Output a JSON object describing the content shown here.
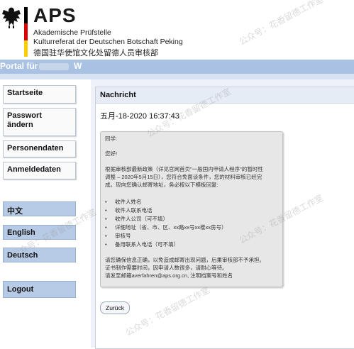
{
  "header": {
    "logo_text": "APS",
    "subtitle_de_1": "Akademische Prüfstelle",
    "subtitle_de_2": "Kulturreferat der Deutschen Botschaft Peking",
    "subtitle_cn": "德国驻华使馆文化处留德人员审核部",
    "flag_colors": [
      "#000000",
      "#dd0000",
      "#ffce00"
    ]
  },
  "portal": {
    "label": "Portal für",
    "name_suffix": "W"
  },
  "sidebar": {
    "items": [
      {
        "label": "Startseite"
      },
      {
        "label": "Passwort\nändern"
      },
      {
        "label": "Personendaten"
      },
      {
        "label": "Anmeldedaten"
      }
    ],
    "languages": [
      {
        "label": "中文"
      },
      {
        "label": "English"
      },
      {
        "label": "Deutsch"
      }
    ],
    "logout": "Logout"
  },
  "message": {
    "title": "Nachricht",
    "date": "五月-18-2020 16:37:43",
    "body": {
      "greeting": "同学:",
      "hello": "您好!",
      "para1_line1": "根据审核部最新政策（详见官网首页\"一般国内申请人程序\"的暂时性",
      "para1_line2": "调整 – 2020年5月15日），您符合免面谈条件，您的材料审核已经完",
      "para1_line3": "成。现向您确认邮寄地址，务必按以下模板回复:",
      "bullets": [
        "收件人姓名",
        "收件人联系电话",
        "收件人公司（可不填）",
        "详细地址（省、市、区、xx路xx号xx楼xx房号）",
        "审核号",
        "备用联系人电话（可不填）"
      ],
      "para2_line1": "请您确保信息正确，以免造成邮寄出现问题，后果审核部不予承担。",
      "para2_line2": "证书制作需要时间，因申请人数很多，请耐心等待。",
      "para2_line3": "请发至邮箱averfahren@aps.org.cn, 注明档案号和姓名"
    },
    "back_button": "Zurück"
  },
  "watermark": {
    "text": "公众号：花香留德工作室"
  },
  "colors": {
    "portal_bar": "#a9c1e2",
    "language_button": "#b7cbe6",
    "panel_header": "#e5ecf5"
  }
}
